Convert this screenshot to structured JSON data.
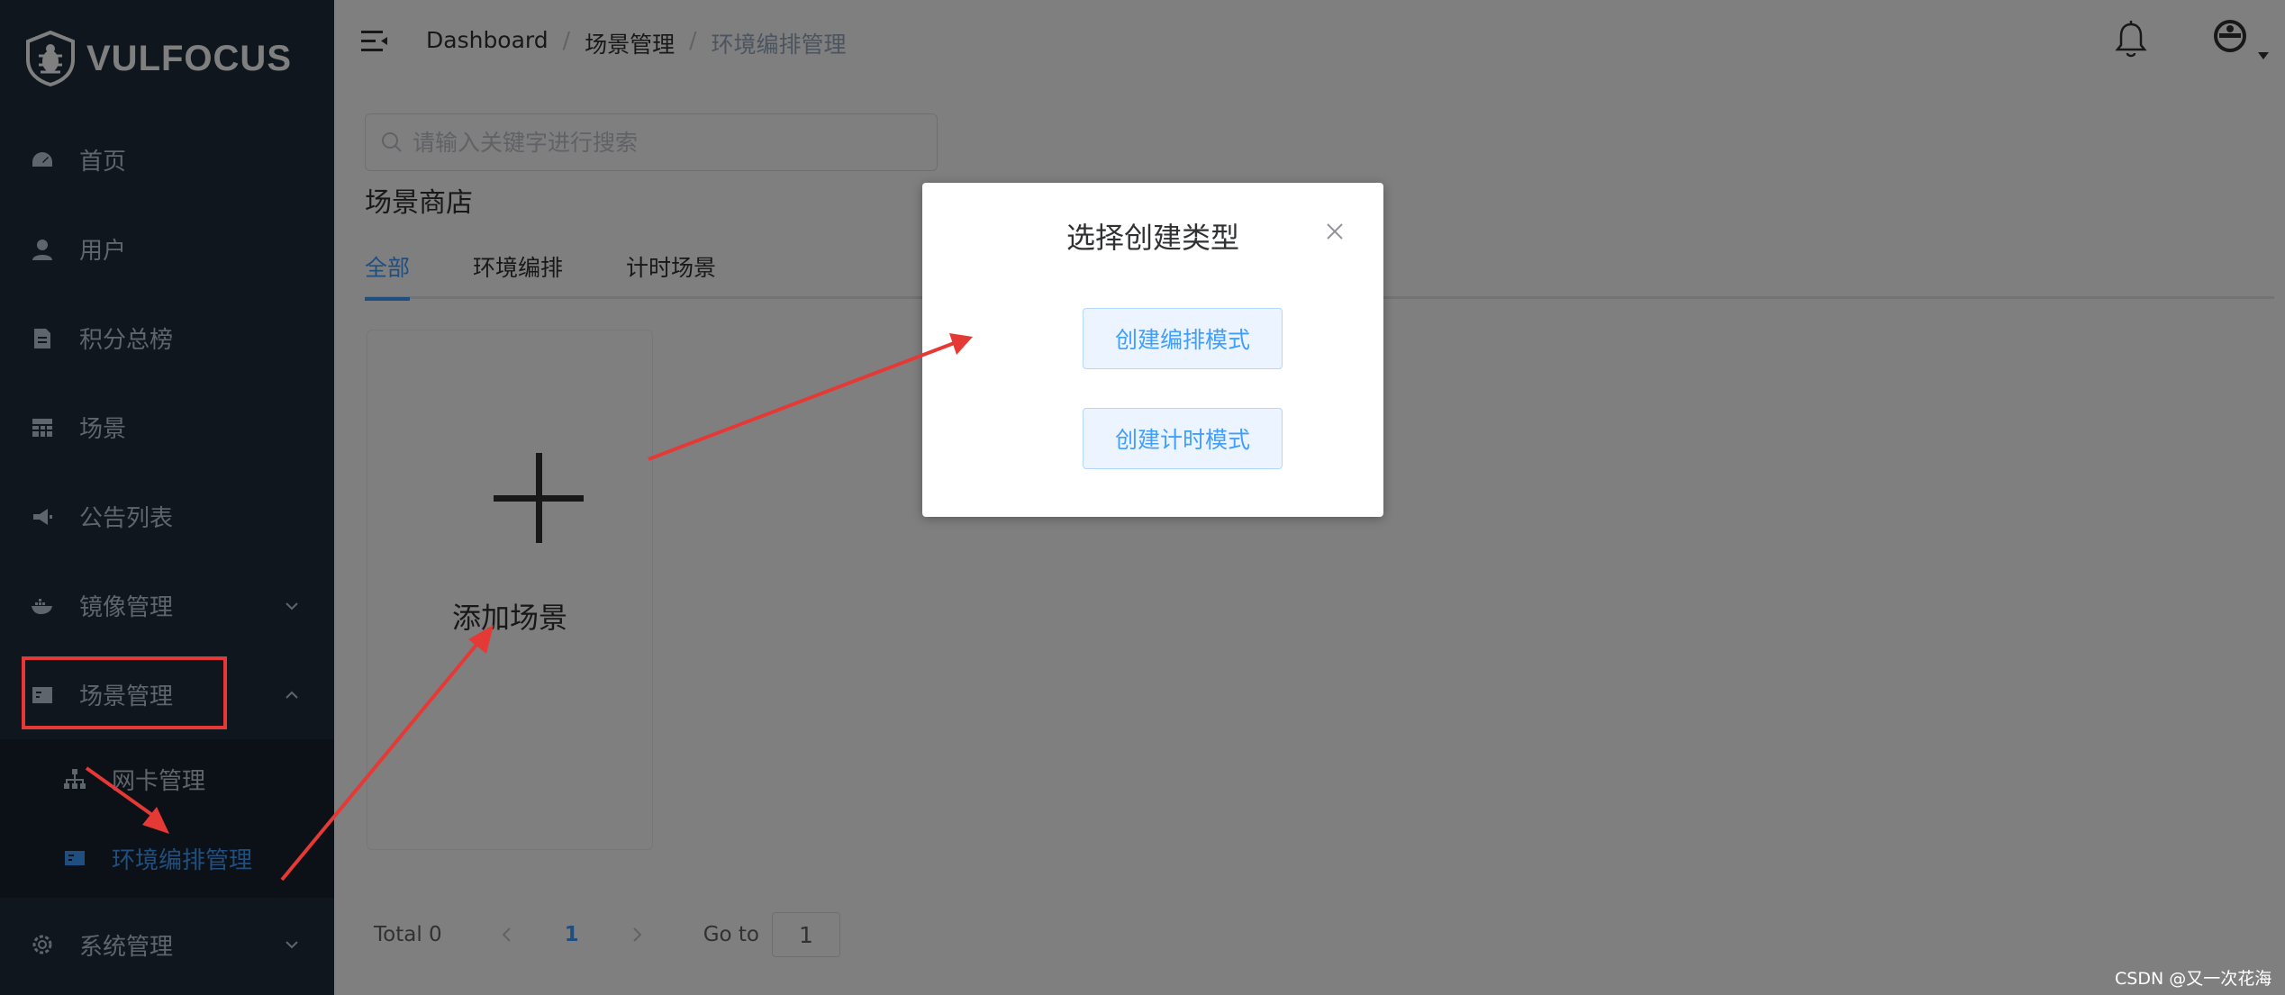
{
  "brand": {
    "name": "VULFOCUS"
  },
  "sidebar": {
    "items": [
      {
        "label": "首页",
        "icon": "dashboard-icon"
      },
      {
        "label": "用户",
        "icon": "user-icon"
      },
      {
        "label": "积分总榜",
        "icon": "document-icon"
      },
      {
        "label": "场景",
        "icon": "grid-icon"
      },
      {
        "label": "公告列表",
        "icon": "megaphone-icon"
      },
      {
        "label": "镜像管理",
        "icon": "docker-icon"
      },
      {
        "label": "场景管理",
        "icon": "card-icon"
      },
      {
        "label": "系统管理",
        "icon": "gear-icon"
      }
    ],
    "submenu": [
      {
        "label": "网卡管理",
        "icon": "network-icon"
      },
      {
        "label": "环境编排管理",
        "icon": "card-icon",
        "active": true
      }
    ]
  },
  "header": {
    "breadcrumb": [
      "Dashboard",
      "场景管理",
      "环境编排管理"
    ],
    "separator": "/"
  },
  "main": {
    "search_placeholder": "请输入关键字进行搜索",
    "store_title": "场景商店",
    "tabs": [
      {
        "label": "全部",
        "active": true
      },
      {
        "label": "环境编排"
      },
      {
        "label": "计时场景"
      }
    ],
    "add_card_label": "添加场景"
  },
  "pagination": {
    "total": "Total 0",
    "current_page": "1",
    "goto_label": "Go to",
    "goto_value": "1"
  },
  "dialog": {
    "title": "选择创建类型",
    "button_orchestration": "创建编排模式",
    "button_timed": "创建计时模式"
  },
  "watermark": "CSDN @又一次花海",
  "colors": {
    "sidebar_bg": "#1f2d3d",
    "accent": "#409eff",
    "annotation_red": "#e53935"
  }
}
